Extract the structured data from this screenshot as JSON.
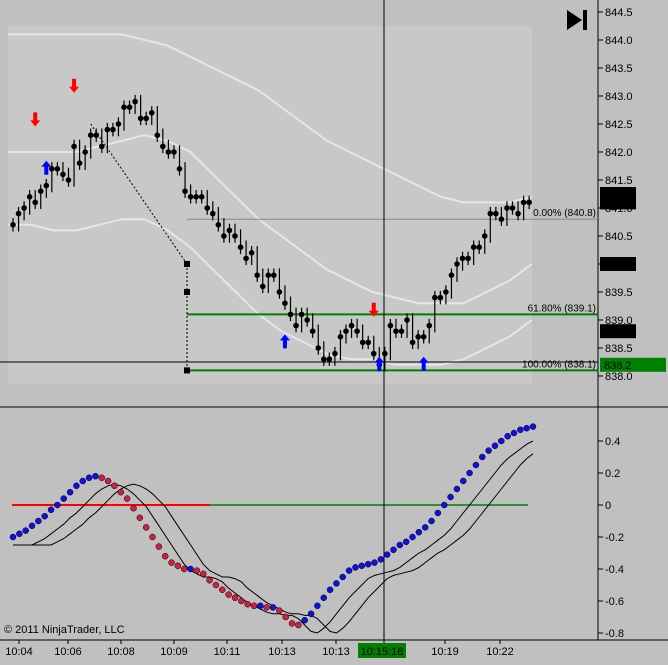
{
  "copyright": "© 2011 NinjaTrader, LLC",
  "colors": {
    "background": "#c0c0c0",
    "panel_bg": "#c8c8c8",
    "band": "#e6e6e6",
    "fib_line": "#008000",
    "zero_line": "#008000",
    "signal_line": "#ff0000",
    "up_arrow": "#0000ff",
    "down_arrow": "#ff0000",
    "dot_blue": "#1010e0",
    "dot_red": "#d02040",
    "cursor_label_bg": "#008000"
  },
  "icons": {
    "go_to_end": "skip-to-end-icon"
  },
  "price_chart": {
    "type": "candlestick",
    "y_ticks": [
      "844.5",
      "844.0",
      "843.5",
      "843.0",
      "842.5",
      "842.0",
      "841.5",
      "841.0",
      "840.5",
      "840.0",
      "839.5",
      "839.0",
      "838.5",
      "838.0"
    ],
    "ylim": [
      837.9,
      844.6
    ],
    "price_tags": [
      {
        "text": "841.2",
        "price": 841.25,
        "style": "black"
      },
      {
        "text": "841.1",
        "price": 841.1,
        "style": "black"
      },
      {
        "text": "840.0",
        "price": 840.0,
        "style": "black"
      },
      {
        "text": "838.8",
        "price": 838.8,
        "style": "black"
      },
      {
        "text": "838.2",
        "price": 838.2,
        "style": "green"
      }
    ],
    "fib_levels": [
      {
        "label": "0.00% (840.8)",
        "price": 840.8,
        "color": "#888888"
      },
      {
        "label": "61.80% (839.1)",
        "price": 839.1,
        "color": "#008000"
      },
      {
        "label": "100.00% (838.1)",
        "price": 838.1,
        "color": "#008000"
      }
    ],
    "closes": [
      840.7,
      840.9,
      841.0,
      841.2,
      841.1,
      841.3,
      841.4,
      841.7,
      841.7,
      841.6,
      841.5,
      842.1,
      841.8,
      842.0,
      842.3,
      842.3,
      842.1,
      842.4,
      842.4,
      842.5,
      842.8,
      842.8,
      842.9,
      842.6,
      842.6,
      842.7,
      842.3,
      842.1,
      842.0,
      842.0,
      841.7,
      841.3,
      841.2,
      841.2,
      841.2,
      841.0,
      840.9,
      840.7,
      840.5,
      840.6,
      840.5,
      840.3,
      840.1,
      840.2,
      839.8,
      839.6,
      839.8,
      839.8,
      839.5,
      839.3,
      839.1,
      838.9,
      839.1,
      839.0,
      838.8,
      838.5,
      838.3,
      838.3,
      838.4,
      838.7,
      838.8,
      838.9,
      838.8,
      838.6,
      838.6,
      838.4,
      838.2,
      838.4,
      838.9,
      838.8,
      838.8,
      839.0,
      838.6,
      838.7,
      838.7,
      838.9,
      839.4,
      839.4,
      839.5,
      839.8,
      840.0,
      840.1,
      840.1,
      840.3,
      840.3,
      840.5,
      840.9,
      840.9,
      840.8,
      841.0,
      841.0,
      840.9,
      841.1,
      841.1
    ],
    "signals": [
      {
        "bar": 4,
        "dir": "down",
        "price": 842.6
      },
      {
        "bar": 6,
        "dir": "up",
        "price": 841.7
      },
      {
        "bar": 11,
        "dir": "down",
        "price": 843.2
      },
      {
        "bar": 49,
        "dir": "up",
        "price": 838.6
      },
      {
        "bar": 65,
        "dir": "down",
        "price": 839.2
      },
      {
        "bar": 66,
        "dir": "up",
        "price": 838.2
      },
      {
        "bar": 74,
        "dir": "up",
        "price": 838.2
      }
    ],
    "band_upper": [
      844.1,
      844.1,
      844.1,
      844.1,
      844.1,
      844.1,
      844.0,
      843.9,
      843.7,
      843.5,
      843.3,
      843.1,
      842.8,
      842.5,
      842.2,
      842.0,
      841.8,
      841.6,
      841.4,
      841.2,
      841.1,
      841.1,
      841.1,
      841.2
    ],
    "band_mid": [
      842.0,
      842.0,
      842.0,
      842.0,
      842.1,
      842.2,
      842.3,
      842.2,
      842.0,
      841.6,
      841.2,
      840.8,
      840.5,
      840.2,
      839.9,
      839.7,
      839.5,
      839.4,
      839.3,
      839.3,
      839.3,
      839.5,
      839.7,
      840.0
    ],
    "band_lower": [
      840.7,
      840.7,
      840.6,
      840.6,
      840.7,
      840.8,
      840.8,
      840.6,
      840.3,
      839.9,
      839.5,
      839.1,
      838.8,
      838.6,
      838.4,
      838.3,
      838.3,
      838.2,
      838.2,
      838.2,
      838.3,
      838.5,
      838.7,
      839.0
    ]
  },
  "oscillator": {
    "y_ticks": [
      "0.4",
      "0.2",
      "0",
      "-0.2",
      "-0.4",
      "-0.6",
      "-0.8"
    ],
    "ylim": [
      -0.82,
      0.56
    ],
    "values": [
      -0.2,
      -0.18,
      -0.16,
      -0.13,
      -0.1,
      -0.07,
      -0.03,
      0,
      0.04,
      0.08,
      0.12,
      0.15,
      0.17,
      0.18,
      0.17,
      0.15,
      0.12,
      0.08,
      0.04,
      -0.02,
      -0.08,
      -0.14,
      -0.2,
      -0.26,
      -0.32,
      -0.36,
      -0.38,
      -0.4,
      -0.4,
      -0.41,
      -0.43,
      -0.47,
      -0.5,
      -0.53,
      -0.56,
      -0.58,
      -0.6,
      -0.62,
      -0.63,
      -0.63,
      -0.64,
      -0.64,
      -0.66,
      -0.7,
      -0.74,
      -0.75,
      -0.72,
      -0.68,
      -0.63,
      -0.58,
      -0.53,
      -0.49,
      -0.45,
      -0.41,
      -0.39,
      -0.38,
      -0.37,
      -0.36,
      -0.34,
      -0.31,
      -0.28,
      -0.25,
      -0.23,
      -0.2,
      -0.17,
      -0.14,
      -0.1,
      -0.05,
      0,
      0.05,
      0.1,
      0.15,
      0.2,
      0.25,
      0.3,
      0.34,
      0.37,
      0.4,
      0.43,
      0.45,
      0.47,
      0.48,
      0.49
    ],
    "rising_color": "blue",
    "falling_color": "red"
  },
  "x_axis": {
    "labels": [
      "10:04",
      "10:06",
      "10:08",
      "10:09",
      "10:11",
      "10:13",
      "10:13",
      "10:19",
      "10:22"
    ],
    "cursor_label": "10:15:18"
  }
}
